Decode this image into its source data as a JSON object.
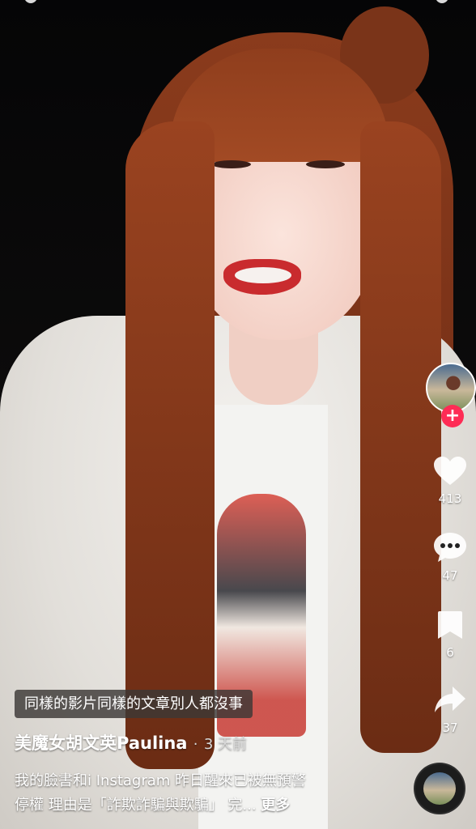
{
  "video": {
    "caption_overlay": "同樣的影片同樣的文章別人都沒事"
  },
  "author": {
    "name": "美魔女胡文英Paulina",
    "separator": "·",
    "time_ago": "3 天前"
  },
  "description": {
    "line1": "我的臉書和i Instagram 昨日醒來已被無預警",
    "line2": "停權 理由是「詐欺詐騙與欺騙」 完...",
    "more_label": "更多"
  },
  "actions": {
    "like_count": "413",
    "comment_count": "47",
    "save_count": "6",
    "share_count": "37",
    "follow_symbol": "+"
  },
  "colors": {
    "follow_badge": "#fe2c55",
    "caption_chip_bg": "#3c3836"
  },
  "icons": {
    "like": "heart-icon",
    "comment": "speech-bubble-icon",
    "save": "bookmark-icon",
    "share": "share-arrow-icon"
  }
}
